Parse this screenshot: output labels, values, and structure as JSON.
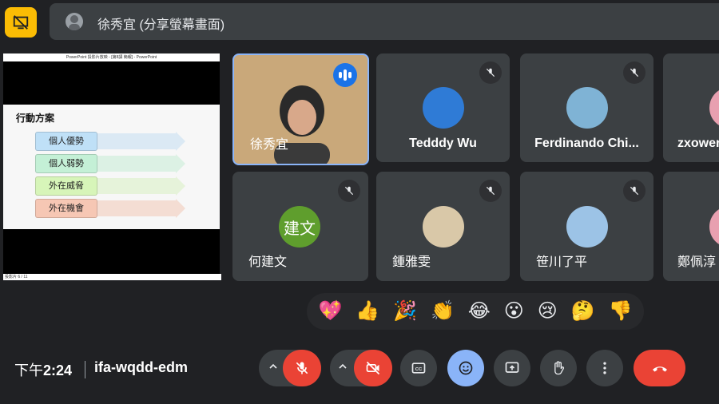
{
  "top": {
    "presenter_label": "徐秀宜 (分享螢幕畫面)"
  },
  "slide": {
    "window_title": "PowerPoint 投影片放映 - [第8講 簡報] - PowerPoint",
    "title": "行動方案",
    "items": [
      {
        "label": "個人優勢",
        "color": "#bfe0f7"
      },
      {
        "label": "個人弱勢",
        "color": "#c4f0d6"
      },
      {
        "label": "外在威脅",
        "color": "#d7f5b9"
      },
      {
        "label": "外在機會",
        "color": "#f6c7b4"
      }
    ],
    "status": "投影片 6 / 11"
  },
  "tiles": [
    {
      "name": "徐秀宜",
      "speaking": true
    },
    {
      "name": "Tedddy Wu",
      "avatar_color": "#2f7bd6"
    },
    {
      "name": "Ferdinando Chi...",
      "avatar_color": "#7fb3d5"
    },
    {
      "name": "zxower",
      "avatar_color": "#e8a0b0"
    },
    {
      "name": "何建文",
      "avatar_text": "建文",
      "avatar_color": "#5f9e2d"
    },
    {
      "name": "鍾雅雯",
      "avatar_color": "#d9c8a8"
    },
    {
      "name": "笹川了平",
      "avatar_color": "#9cc3e6"
    },
    {
      "name": "鄭佩淳",
      "avatar_color": "#e8a0b0"
    }
  ],
  "reactions": [
    "💖",
    "👍",
    "🎉",
    "👏",
    "😂",
    "😮",
    "😢",
    "🤔",
    "👎"
  ],
  "bottom": {
    "time_prefix": "下午",
    "time": "2:24",
    "meeting_code": "ifa-wqdd-edm"
  },
  "colors": {
    "accent_yellow": "#fbbc04",
    "end_call_red": "#ea4335",
    "emoji_blue": "#8ab4f8"
  }
}
